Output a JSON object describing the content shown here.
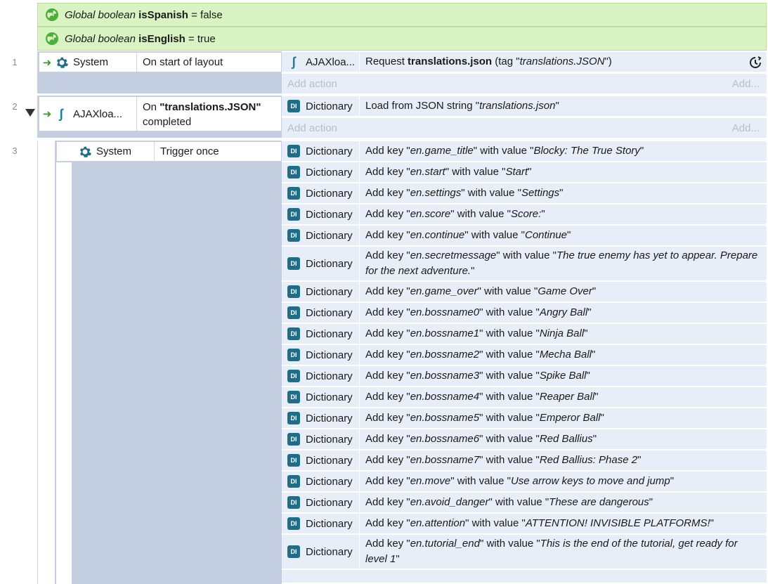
{
  "globals": [
    {
      "prefix": "Global boolean",
      "name": "isSpanish",
      "rest": "= false"
    },
    {
      "prefix": "Global boolean",
      "name": "isEnglish",
      "rest": "= true"
    }
  ],
  "rows": [
    "1",
    "2",
    "3"
  ],
  "event1": {
    "object": "System",
    "condition": "On start of layout",
    "action_object": "AJAXloa...",
    "action_pre": "Request",
    "action_bold": "translations.json",
    "action_mid": "(tag \"",
    "action_italic": "translations.JSON",
    "action_post": "\")",
    "add_action": "Add action",
    "add_short": "Add..."
  },
  "event2": {
    "object": "AJAXloa...",
    "condition_pre": "On",
    "condition_bold": "\"translations.JSON\"",
    "condition_post": "completed",
    "action_object": "Dictionary",
    "action_pre": "Load from JSON string \"",
    "action_italic": "translations.json",
    "action_post": "\"",
    "add_action": "Add action",
    "add_short": "Add..."
  },
  "event3": {
    "object": "System",
    "condition": "Trigger once",
    "actions": [
      {
        "object": "Dictionary",
        "key": "en.game_title",
        "value": "Blocky: The True Story"
      },
      {
        "object": "Dictionary",
        "key": "en.start",
        "value": "Start"
      },
      {
        "object": "Dictionary",
        "key": "en.settings",
        "value": "Settings"
      },
      {
        "object": "Dictionary",
        "key": "en.score",
        "value": "Score:"
      },
      {
        "object": "Dictionary",
        "key": "en.continue",
        "value": "Continue"
      },
      {
        "object": "Dictionary",
        "key": "en.secretmessage",
        "value": "The true enemy has yet to appear. Prepare for the next adventure."
      },
      {
        "object": "Dictionary",
        "key": "en.game_over",
        "value": "Game Over"
      },
      {
        "object": "Dictionary",
        "key": "en.bossname0",
        "value": "Angry Ball"
      },
      {
        "object": "Dictionary",
        "key": "en.bossname1",
        "value": "Ninja Ball"
      },
      {
        "object": "Dictionary",
        "key": "en.bossname2",
        "value": "Mecha Ball"
      },
      {
        "object": "Dictionary",
        "key": "en.bossname3",
        "value": "Spike Ball"
      },
      {
        "object": "Dictionary",
        "key": "en.bossname4",
        "value": "Reaper Ball"
      },
      {
        "object": "Dictionary",
        "key": "en.bossname5",
        "value": "Emperor Ball"
      },
      {
        "object": "Dictionary",
        "key": "en.bossname6",
        "value": "Red Ballius"
      },
      {
        "object": "Dictionary",
        "key": "en.bossname7",
        "value": "Red Ballius: Phase 2"
      },
      {
        "object": "Dictionary",
        "key": "en.move",
        "value": "Use arrow keys to move and jump"
      },
      {
        "object": "Dictionary",
        "key": "en.avoid_danger",
        "value": "These are dangerous"
      },
      {
        "object": "Dictionary",
        "key": "en.attention",
        "value": "ATTENTION! INVISIBLE PLATFORMS!"
      },
      {
        "object": "Dictionary",
        "key": "en.tutorial_end",
        "value": "This is the end of the tutorial, get ready for level 1"
      }
    ],
    "add_key_label": "Add key",
    "with_value_label": "with value"
  },
  "colors": {
    "global_bg": "#d9f3c3",
    "condition_block": "#c3cfe0",
    "action_bg": "#e8eef7",
    "dictionary_icon": "#1e6e8a",
    "trigger_arrow": "#3a9c27"
  },
  "icons": {
    "global": "globe-icon",
    "system": "gear-icon",
    "ajax": "ajax-icon",
    "dictionary": "dictionary-icon",
    "refresh": "refresh-icon"
  }
}
